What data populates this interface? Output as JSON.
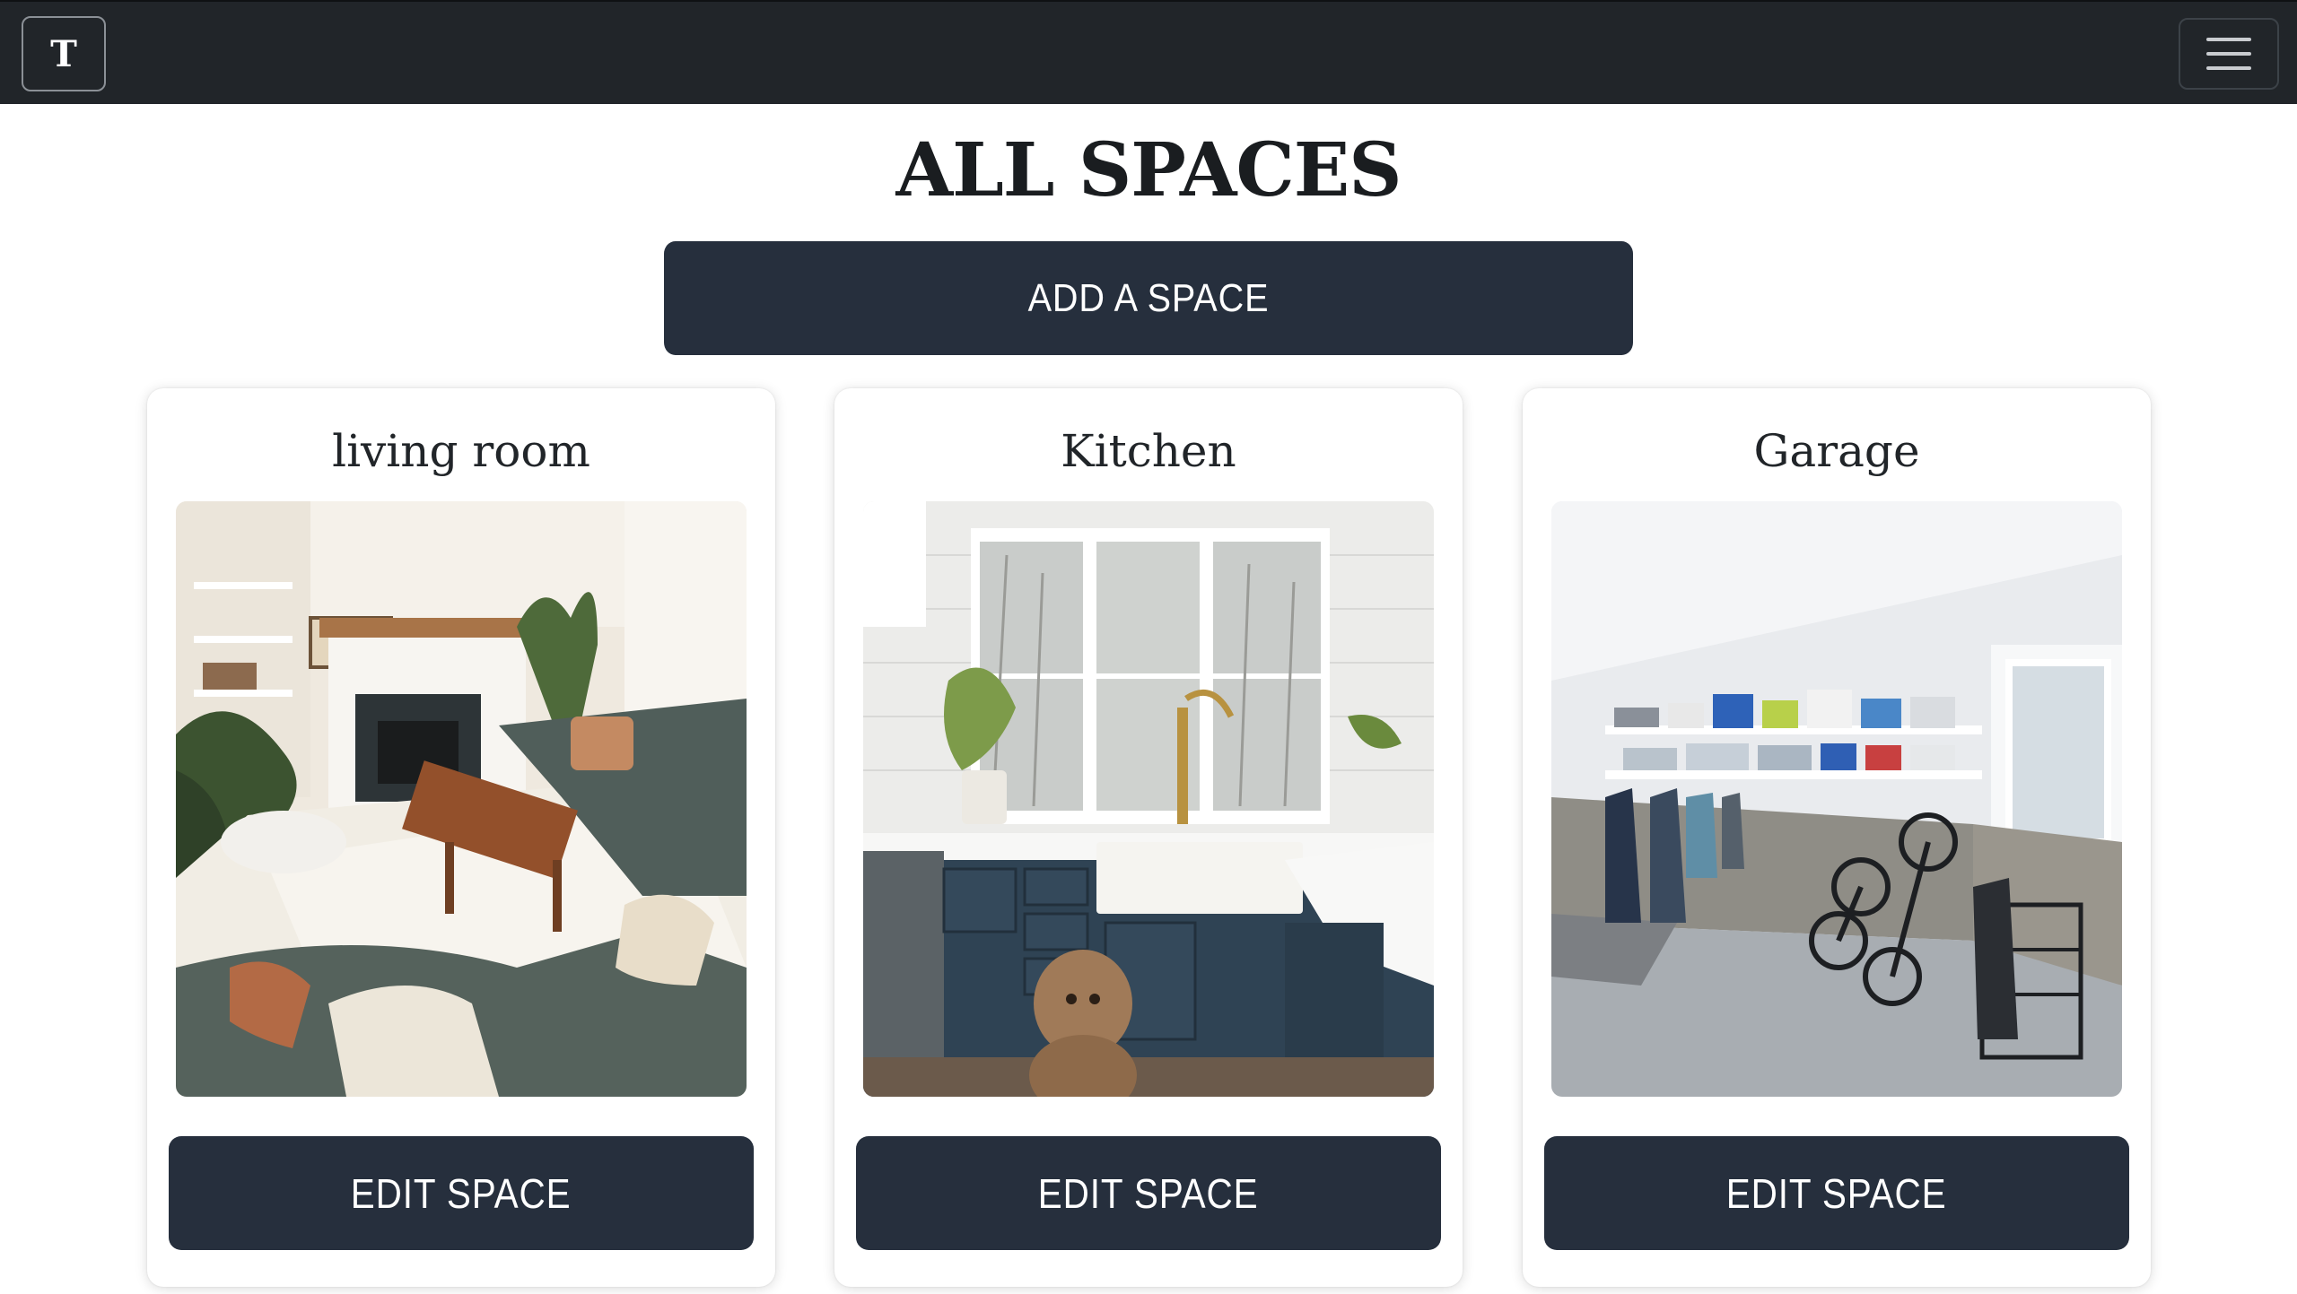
{
  "navbar": {
    "brand_letter": "T",
    "menu_icon": "hamburger-menu-icon",
    "background": "#212529"
  },
  "page": {
    "title": "ALL SPACES",
    "add_button_label": "ADD A SPACE"
  },
  "spaces": [
    {
      "name": "living room",
      "edit_label": "EDIT SPACE"
    },
    {
      "name": "Kitchen",
      "edit_label": "EDIT SPACE"
    },
    {
      "name": "Garage",
      "edit_label": "EDIT SPACE"
    }
  ],
  "colors": {
    "button": "#262f3d",
    "button_text": "#ffffff",
    "title_text": "#1a1d20"
  }
}
